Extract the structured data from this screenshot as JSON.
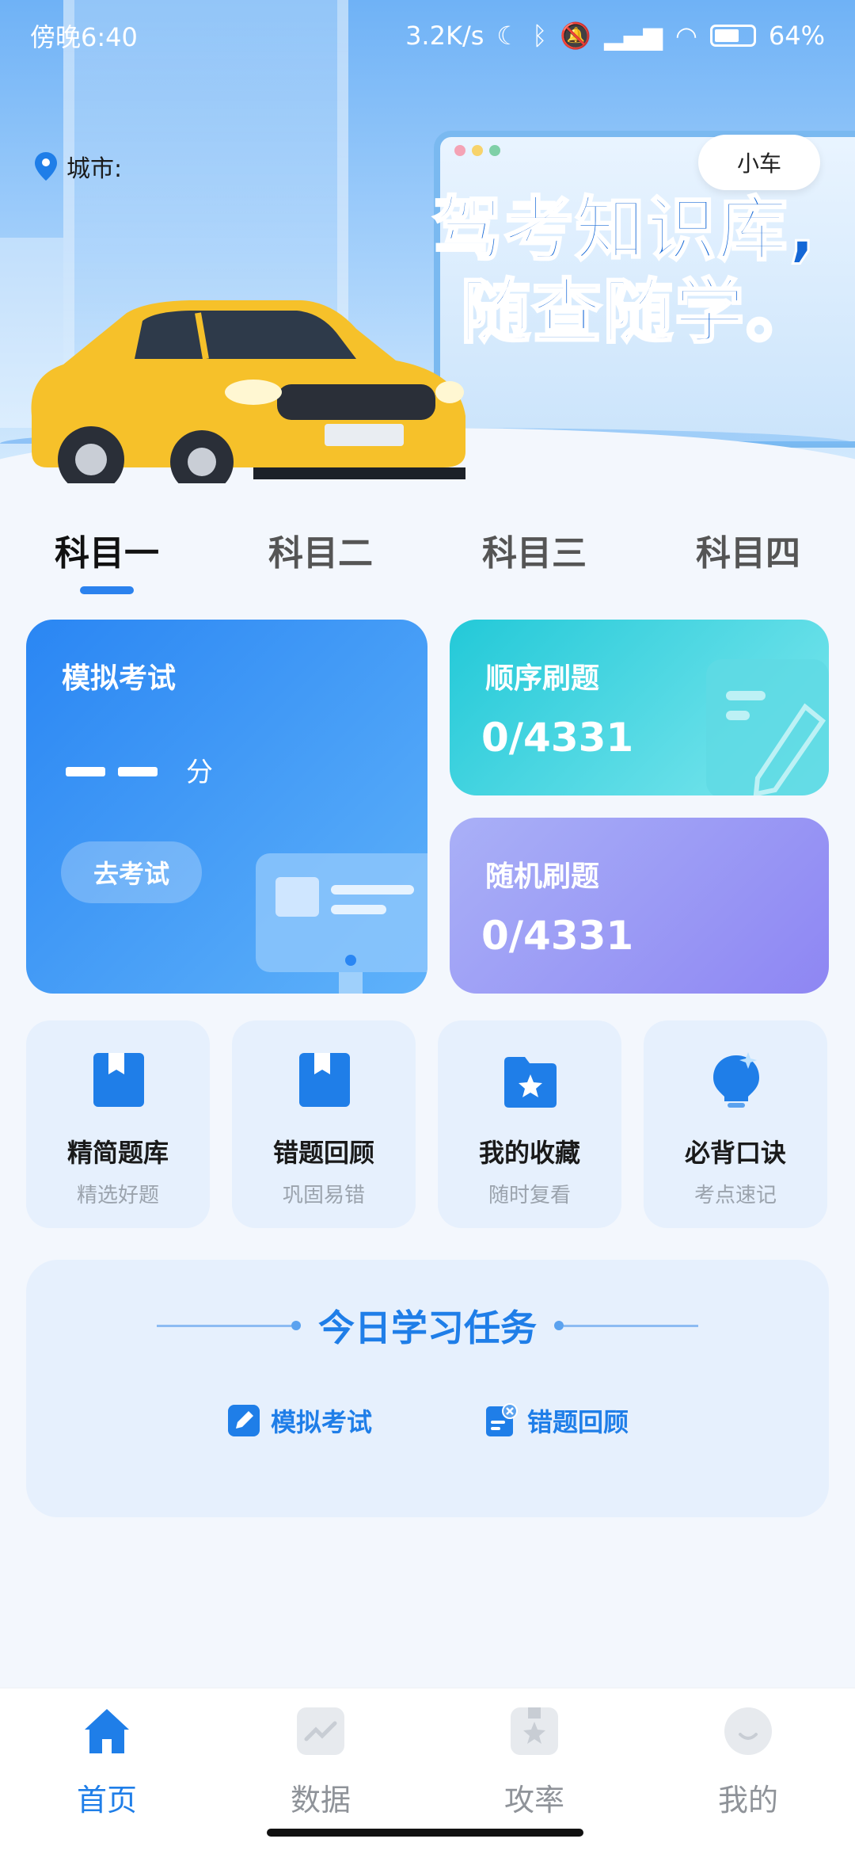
{
  "status_bar": {
    "time": "傍晚6:40",
    "speed": "3.2K/s",
    "battery": "64%"
  },
  "banner": {
    "city_label": "城市:",
    "vehicle_chip": "小车",
    "headline_line1": "驾考知识库,",
    "headline_line2": "随查随学。"
  },
  "subject_tabs": [
    {
      "label": "科目一",
      "active": true
    },
    {
      "label": "科目二",
      "active": false
    },
    {
      "label": "科目三",
      "active": false
    },
    {
      "label": "科目四",
      "active": false
    }
  ],
  "cards": {
    "mock_exam": {
      "title": "模拟考试",
      "score_unit": "分",
      "button": "去考试"
    },
    "sequential": {
      "title": "顺序刷题",
      "count": "0/4331"
    },
    "random": {
      "title": "随机刷题",
      "count": "0/4331"
    }
  },
  "tiles": [
    {
      "title": "精简题库",
      "subtitle": "精选好题",
      "icon": "bookmark-book-icon"
    },
    {
      "title": "错题回顾",
      "subtitle": "巩固易错",
      "icon": "bookmark-book-icon"
    },
    {
      "title": "我的收藏",
      "subtitle": "随时复看",
      "icon": "star-folder-icon"
    },
    {
      "title": "必背口诀",
      "subtitle": "考点速记",
      "icon": "lightbulb-icon"
    }
  ],
  "daily_task": {
    "title": "今日学习任务",
    "items": [
      {
        "label": "模拟考试",
        "icon": "pencil-icon"
      },
      {
        "label": "错题回顾",
        "icon": "wrong-doc-icon"
      }
    ]
  },
  "bottom_nav": [
    {
      "label": "首页",
      "icon": "home-icon",
      "active": true
    },
    {
      "label": "数据",
      "icon": "chart-icon",
      "active": false
    },
    {
      "label": "攻率",
      "icon": "guide-icon",
      "active": false
    },
    {
      "label": "我的",
      "icon": "profile-icon",
      "active": false
    }
  ],
  "colors": {
    "accent": "#1f7ee8",
    "exam_card": "#2a86f3",
    "sequential_card": "#23c9d8",
    "random_card": "#9c9af5",
    "tile_bg": "#e6f0fd"
  }
}
